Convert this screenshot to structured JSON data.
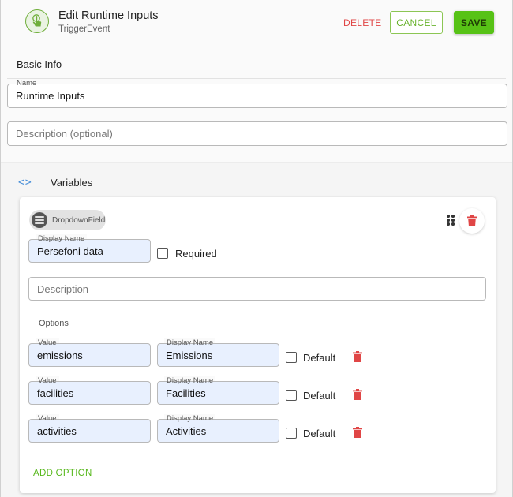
{
  "header": {
    "title": "Edit Runtime Inputs",
    "subtitle": "TriggerEvent",
    "delete_label": "DELETE",
    "cancel_label": "CANCEL",
    "save_label": "SAVE"
  },
  "basic_info": {
    "heading": "Basic Info",
    "name": {
      "label": "Name",
      "value": "Runtime Inputs"
    },
    "description": {
      "placeholder": "Description (optional)"
    }
  },
  "variables": {
    "heading": "Variables",
    "field": {
      "type_chip": "DropdownField",
      "display_name": {
        "label": "Display Name",
        "value": "Persefoni data"
      },
      "required_label": "Required",
      "description_placeholder": "Description",
      "options_heading": "Options",
      "options": [
        {
          "value_label": "Value",
          "value": "emissions",
          "display_label": "Display Name",
          "display": "Emissions",
          "default_label": "Default"
        },
        {
          "value_label": "Value",
          "value": "facilities",
          "display_label": "Display Name",
          "display": "Facilities",
          "default_label": "Default"
        },
        {
          "value_label": "Value",
          "value": "activities",
          "display_label": "Display Name",
          "display": "Activities",
          "default_label": "Default"
        }
      ],
      "add_option_label": "ADD OPTION"
    }
  },
  "colors": {
    "accent_green": "#57c216",
    "delete_red": "#e04646",
    "icon_blue": "#4a90d9"
  }
}
